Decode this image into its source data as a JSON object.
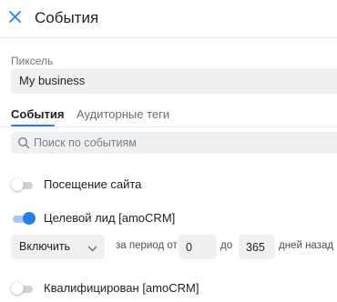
{
  "header": {
    "title": "События",
    "close_icon": "close-icon"
  },
  "pixel": {
    "label": "Пиксель",
    "value": "My business"
  },
  "tabs": [
    {
      "label": "События",
      "active": true
    },
    {
      "label": "Аудиторные теги",
      "active": false
    }
  ],
  "search": {
    "placeholder": "Поиск по событиям",
    "value": ""
  },
  "events": [
    {
      "label": "Посещение сайта",
      "enabled": false
    },
    {
      "label": "Целевой лид [amoCRM]",
      "enabled": true
    },
    {
      "label": "Квалифицирован [amoCRM]",
      "enabled": false
    }
  ],
  "lead_config": {
    "action": "Включить",
    "period_prefix": "за период от",
    "from_value": "0",
    "to_prefix": "до",
    "to_value": "365",
    "suffix": "дней назад"
  },
  "colors": {
    "accent": "#2b7de9",
    "field_bg": "#eef0f2",
    "toggle_off": "#cfd2d6"
  }
}
